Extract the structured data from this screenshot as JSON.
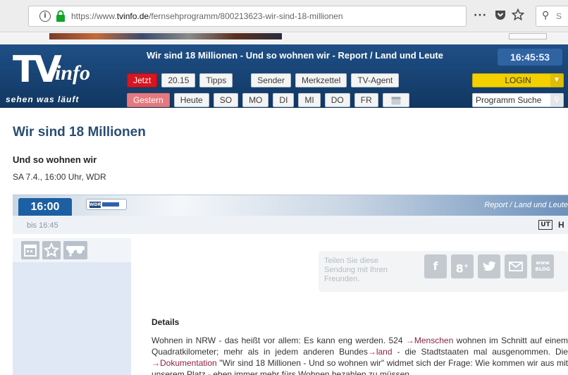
{
  "browser": {
    "url_prefix": "https://www.",
    "url_domain": "tvinfo.de",
    "url_path": "/fernsehprogramm/800213623-wir-sind-18-millionen",
    "menu_glyph": "···",
    "search_placeholder": "S"
  },
  "header": {
    "logo_tv": "TV",
    "logo_info": "info",
    "slogan": "sehen was läuft",
    "title": "Wir sind 18 Millionen - Und so wohnen wir - Report / Land und Leute",
    "clock": "16:45:53",
    "nav_row1": [
      "Jetzt",
      "20.15",
      "Tipps"
    ],
    "nav_row1b": [
      "Sender",
      "Merkzettel",
      "TV-Agent"
    ],
    "nav_row2": [
      "Gestern",
      "Heute",
      "SO",
      "MO",
      "DI",
      "MI",
      "DO",
      "FR"
    ],
    "login": "LOGIN",
    "prog_search": "Programm Suche"
  },
  "show": {
    "title": "Wir sind 18 Millionen",
    "subtitle": "Und so wohnen wir",
    "airinfo": "SA 7.4., 16:00 Uhr, WDR",
    "time": "16:00",
    "channel": "WDR",
    "genre": "Report / Land und Leute",
    "until": "bis 16:45",
    "ut": "UT",
    "hd": "H"
  },
  "share": {
    "text": "Teilen Sie diese Sendung mit Ihren Freunden.",
    "blog_label": "www BLOG"
  },
  "details": {
    "heading": "Details",
    "p1": "Wohnen in NRW - das heißt vor allem: Es kann eng werden. 524 ",
    "l1": "Menschen",
    "p2": " wohnen im Schnitt auf einem Quadratkilometer; mehr als in jedem anderen Bundes",
    "l2": "land",
    "p3": " - die Stadtstaaten mal ausgenommen. Die ",
    "l3": "Dokumentation",
    "p4": " \"Wir sind 18 Millionen - Und so wohnen wir\" widmet sich der Frage: Wie kommen wir aus mit unserem Platz - eben immer mehr fürs Wohnen bezahlen zu müssen"
  }
}
